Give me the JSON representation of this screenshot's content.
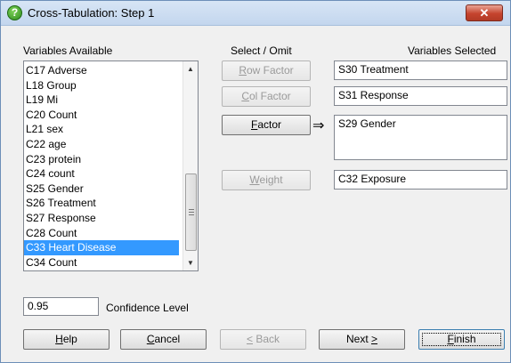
{
  "window": {
    "title": "Cross-Tabulation: Step 1",
    "close_glyph": "✕"
  },
  "headers": {
    "variables_available": "Variables Available",
    "select_omit": "Select / Omit",
    "variables_selected": "Variables Selected"
  },
  "variables": [
    {
      "label": "C17 Adverse"
    },
    {
      "label": "L18 Group"
    },
    {
      "label": "L19 Mi"
    },
    {
      "label": "C20 Count"
    },
    {
      "label": "L21 sex"
    },
    {
      "label": "C22 age"
    },
    {
      "label": "C23 protein"
    },
    {
      "label": "C24 count"
    },
    {
      "label": "S25 Gender"
    },
    {
      "label": "S26 Treatment"
    },
    {
      "label": "S27 Response"
    },
    {
      "label": "C28 Count"
    },
    {
      "label": "C33 Heart Disease",
      "selected": true
    },
    {
      "label": "C34 Count"
    }
  ],
  "buttons": {
    "row_factor": {
      "mn": "R",
      "rest": "ow Factor"
    },
    "col_factor": {
      "mn": "C",
      "rest": "ol Factor"
    },
    "factor": {
      "mn": "F",
      "rest": "actor"
    },
    "weight": {
      "mn": "W",
      "rest": "eight"
    },
    "help": {
      "mn": "H",
      "rest": "elp"
    },
    "cancel": {
      "mn": "C",
      "rest": "ancel"
    },
    "back": {
      "mn": "<",
      "rest": " Back"
    },
    "next": {
      "pre": "Next ",
      "mn": ">"
    },
    "finish": {
      "mn": "F",
      "rest": "inish"
    }
  },
  "selected_fields": {
    "row_factor": "S30 Treatment",
    "col_factor": "S31 Response",
    "factor": "S29 Gender",
    "weight": "C32 Exposure"
  },
  "arrow_glyph": "⇒",
  "confidence": {
    "value": "0.95",
    "label": "Confidence Level"
  },
  "icons": {
    "app": "question-icon",
    "close": "close-icon"
  },
  "colors": {
    "selection": "#3399ff",
    "close_button": "#c5442e",
    "titlebar": "#c3d6ee"
  }
}
